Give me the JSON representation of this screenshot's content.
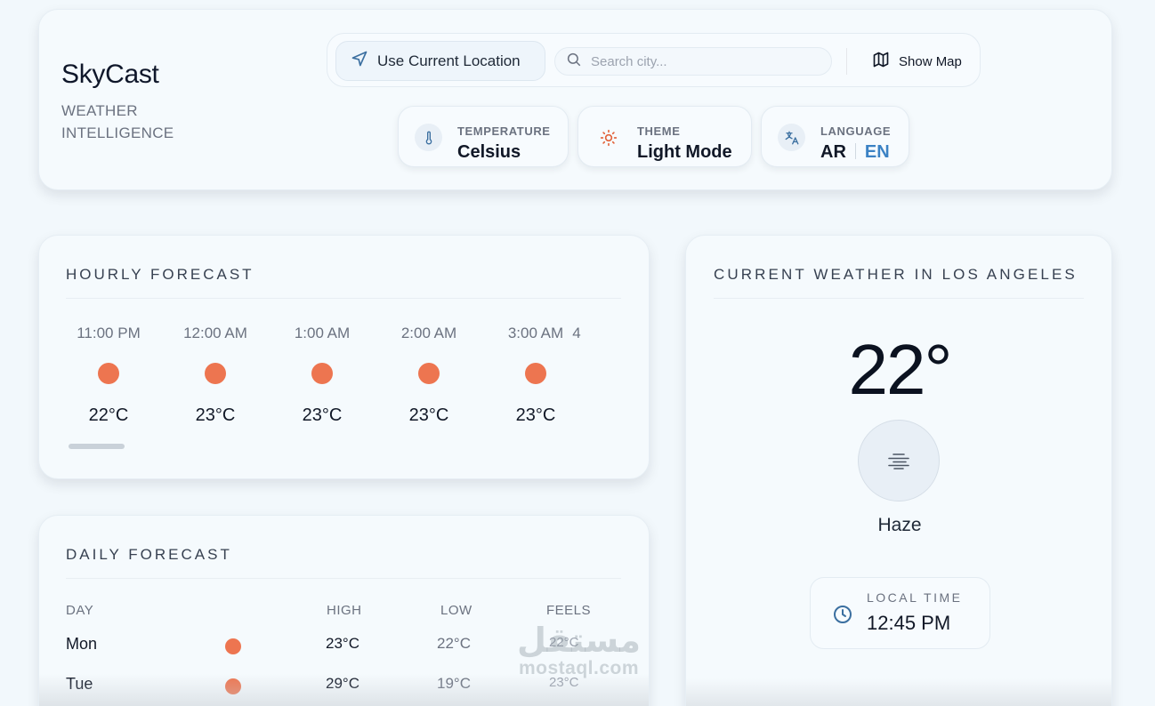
{
  "brand": {
    "title": "SkyCast",
    "subtitle": "WEATHER INTELLIGENCE"
  },
  "toolbar": {
    "location_button": "Use Current Location",
    "search_placeholder": "Search city...",
    "search_value": "",
    "map_button": "Show Map"
  },
  "preferences": {
    "temperature": {
      "label": "TEMPERATURE",
      "value": "Celsius",
      "icon": "thermometer-icon"
    },
    "theme": {
      "label": "THEME",
      "value": "Light Mode",
      "icon": "sun-icon"
    },
    "language": {
      "label": "LANGUAGE",
      "ar": "AR",
      "en": "EN",
      "active": "EN",
      "icon": "translate-icon"
    }
  },
  "hourly": {
    "title": "HOURLY FORECAST",
    "items": [
      {
        "time": "11:00 PM",
        "temp": "22°C"
      },
      {
        "time": "12:00 AM",
        "temp": "23°C"
      },
      {
        "time": "1:00 AM",
        "temp": "23°C"
      },
      {
        "time": "2:00 AM",
        "temp": "23°C"
      },
      {
        "time": "3:00 AM",
        "temp": "23°C"
      },
      {
        "time": "4",
        "temp": ""
      }
    ]
  },
  "daily": {
    "title": "DAILY FORECAST",
    "columns": {
      "day": "DAY",
      "high": "HIGH",
      "low": "LOW",
      "feels": "FEELS"
    },
    "rows": [
      {
        "day": "Mon",
        "high": "23°C",
        "low": "22°C",
        "feels": "22°C"
      },
      {
        "day": "Tue",
        "high": "29°C",
        "low": "19°C",
        "feels": "23°C"
      }
    ]
  },
  "current": {
    "title": "CURRENT WEATHER IN LOS ANGELES",
    "temperature": "22°",
    "condition": "Haze",
    "local_time_label": "LOCAL TIME",
    "local_time": "12:45 PM"
  },
  "watermark": {
    "arabic": "مستقل",
    "latin": "mostaql.com"
  },
  "colors": {
    "accent": "#3b82c4",
    "sun": "#ed7550",
    "background": "#f2f8fc"
  }
}
